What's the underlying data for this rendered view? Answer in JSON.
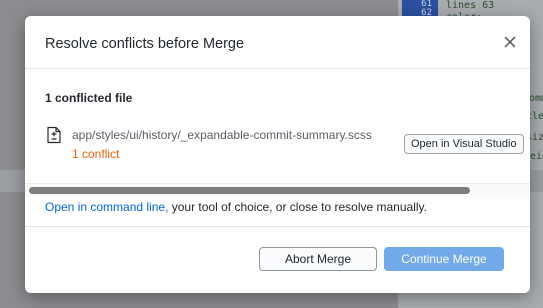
{
  "background": {
    "gutter_lines": [
      "61",
      "62"
    ],
    "code_fragments": [
      "lines 63",
      "color:",
      "commi",
      "cle",
      "size",
      "weig"
    ]
  },
  "dialog": {
    "title": "Resolve conflicts before Merge",
    "close_icon": "close-icon",
    "file_count_label": "1 conflicted file",
    "file": {
      "icon": "file-diff-icon",
      "path": "app/styles/ui/history/_expandable-commit-summary.scss",
      "conflict_label": "1 conflict",
      "open_button_label": "Open in Visual Studio"
    },
    "help": {
      "link_text": "Open in command line,",
      "rest_text": " your tool of choice, or close to resolve manually."
    },
    "buttons": {
      "abort_label": "Abort Merge",
      "continue_label": "Continue Merge"
    }
  },
  "colors": {
    "conflict": "#e36209",
    "link": "#0366d6",
    "primary_button": "#72aae9"
  }
}
